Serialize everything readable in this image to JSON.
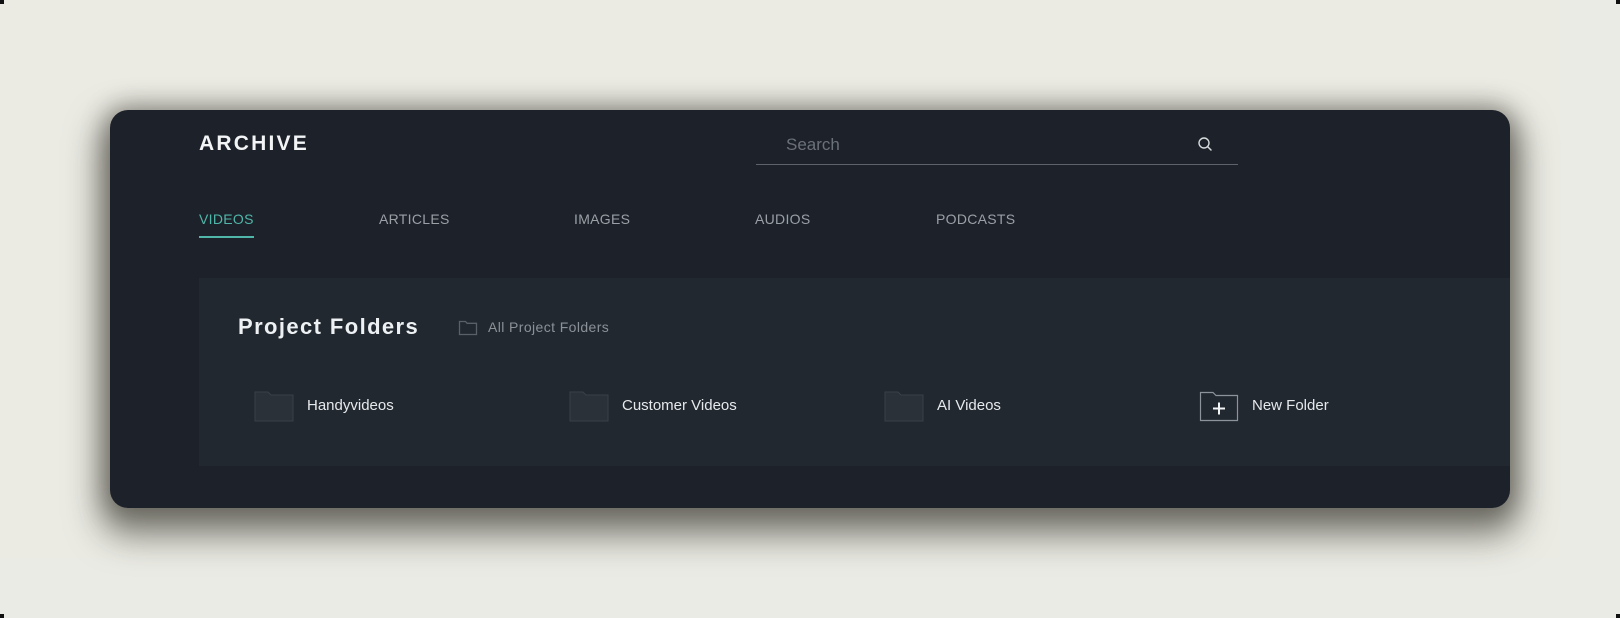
{
  "app": {
    "brand": "ARCHIVE"
  },
  "search": {
    "placeholder": "Search",
    "value": "",
    "icon": "search-icon"
  },
  "tabs": [
    {
      "label": "VIDEOS",
      "active": true
    },
    {
      "label": "ARTICLES",
      "active": false
    },
    {
      "label": "IMAGES",
      "active": false
    },
    {
      "label": "AUDIOS",
      "active": false
    },
    {
      "label": "PODCASTS",
      "active": false
    }
  ],
  "project_folders": {
    "title": "Project Folders",
    "all_link": {
      "label": "All Project Folders",
      "icon": "folder-outline-icon"
    },
    "folders": [
      {
        "name": "Handyvideos",
        "icon": "folder-icon"
      },
      {
        "name": "Customer Videos",
        "icon": "folder-icon"
      },
      {
        "name": "AI Videos",
        "icon": "folder-icon"
      }
    ],
    "new_folder": {
      "label": "New Folder",
      "icon": "new-folder-plus-icon"
    }
  },
  "colors": {
    "page_background": "#ebebe5",
    "card_background": "#1d222a",
    "panel_background": "#222830",
    "accent": "#4fb6a9",
    "text_primary": "#eef1f3",
    "text_muted": "#9aa0a6"
  }
}
